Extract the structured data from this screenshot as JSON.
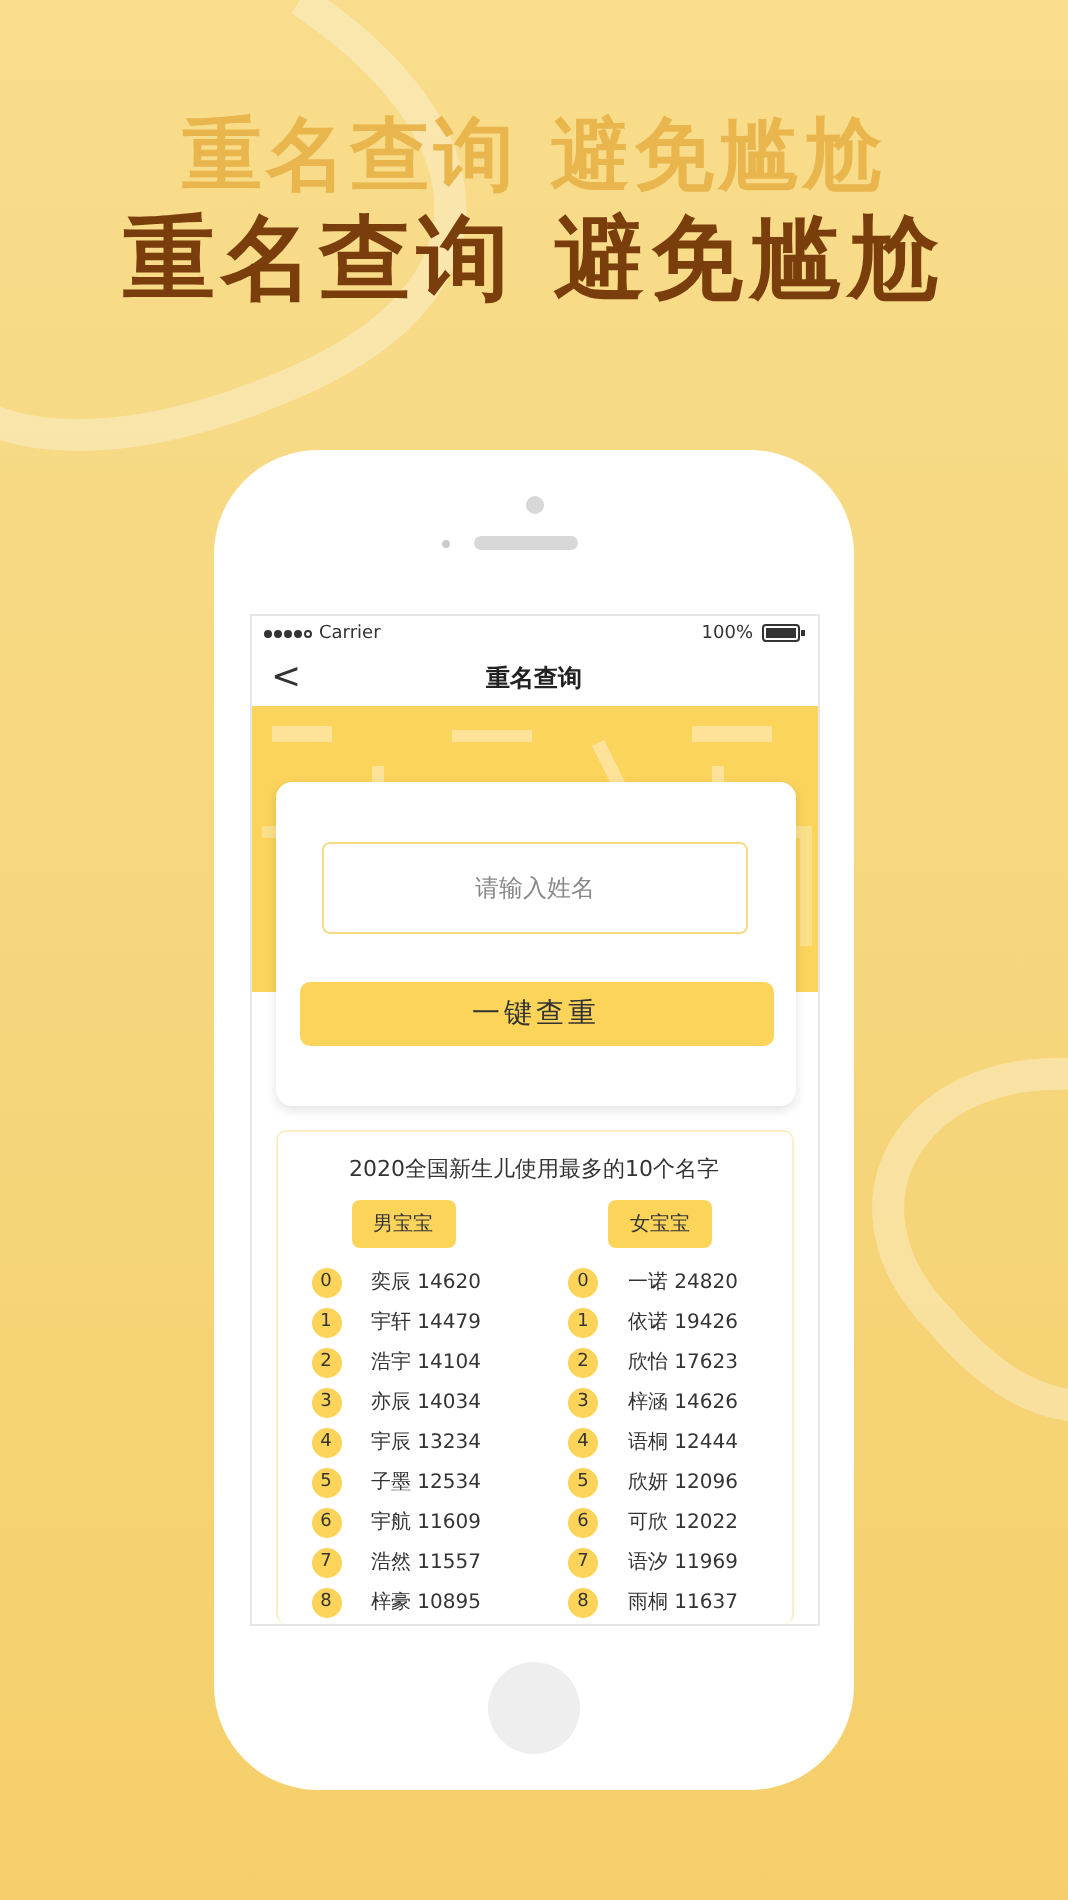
{
  "headline": "重名查询 避免尴尬",
  "headline_echo": "重名查询 避免尴尬",
  "status_bar": {
    "carrier": "Carrier",
    "battery": "100%"
  },
  "nav": {
    "back": "<",
    "title": "重名查询"
  },
  "search": {
    "placeholder": "请输入姓名",
    "button": "一键查重"
  },
  "ranking": {
    "title": "2020全国新生儿使用最多的10个名字",
    "groups": [
      {
        "label": "男宝宝",
        "items": [
          {
            "rank": "0",
            "name": "奕辰 14620"
          },
          {
            "rank": "1",
            "name": "宇轩 14479"
          },
          {
            "rank": "2",
            "name": "浩宇 14104"
          },
          {
            "rank": "3",
            "name": "亦辰 14034"
          },
          {
            "rank": "4",
            "name": "宇辰 13234"
          },
          {
            "rank": "5",
            "name": "子墨 12534"
          },
          {
            "rank": "6",
            "name": "宇航 11609"
          },
          {
            "rank": "7",
            "name": "浩然 11557"
          },
          {
            "rank": "8",
            "name": "梓豪 10895"
          }
        ]
      },
      {
        "label": "女宝宝",
        "items": [
          {
            "rank": "0",
            "name": "一诺 24820"
          },
          {
            "rank": "1",
            "name": "依诺 19426"
          },
          {
            "rank": "2",
            "name": "欣怡 17623"
          },
          {
            "rank": "3",
            "name": "梓涵 14626"
          },
          {
            "rank": "4",
            "name": "语桐 12444"
          },
          {
            "rank": "5",
            "name": "欣妍 12096"
          },
          {
            "rank": "6",
            "name": "可欣 12022"
          },
          {
            "rank": "7",
            "name": "语汐 11969"
          },
          {
            "rank": "8",
            "name": "雨桐 11637"
          }
        ]
      }
    ]
  }
}
